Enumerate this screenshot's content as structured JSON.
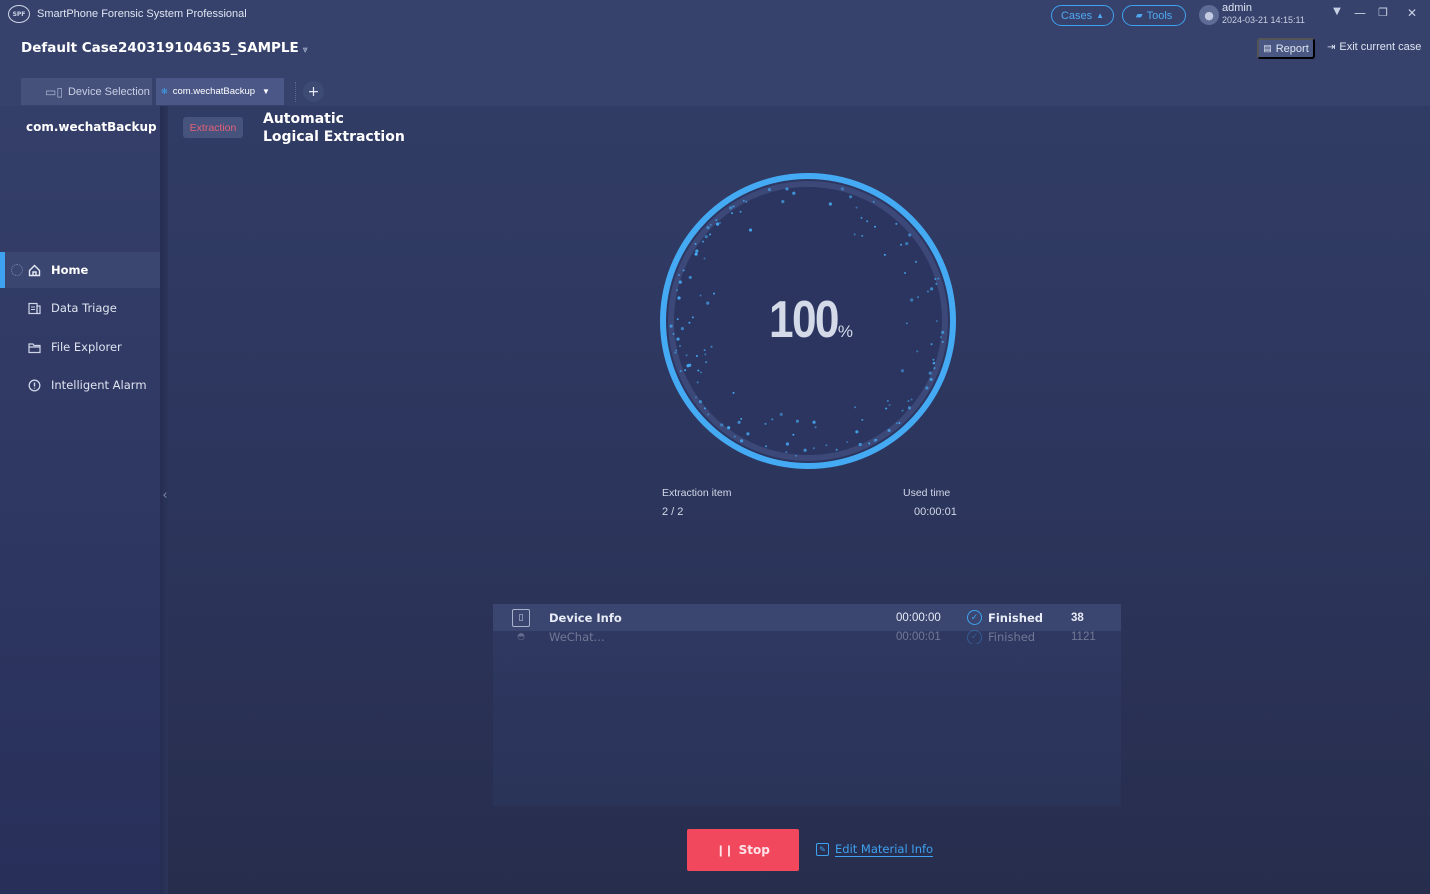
{
  "app": {
    "title": "SmartPhone Forensic System Professional",
    "logo_text": "SPF"
  },
  "header": {
    "cases_label": "Cases",
    "tools_label": "Tools",
    "user": {
      "name": "admin",
      "datetime": "2024-03-21 14:15:11"
    },
    "window_controls": {
      "menu": "▼",
      "minimize": "—",
      "restore": "❐",
      "close": "✕"
    }
  },
  "case": {
    "title": "Default Case240319104635_SAMPLE",
    "caret": "⩔",
    "report_label": "Report",
    "exit_label": "Exit current case"
  },
  "tabs": [
    {
      "label": "Device Selection",
      "icon": "device-icon",
      "active": false
    },
    {
      "label": "com.wechatBackup",
      "icon": "dot-icon",
      "active": true
    }
  ],
  "tab_add_label": "+",
  "sidebar": {
    "title": "com.wechatBackup",
    "items": [
      {
        "label": "Home",
        "icon": "home-icon",
        "active": true
      },
      {
        "label": "Data Triage",
        "icon": "data-triage-icon",
        "active": false
      },
      {
        "label": "File Explorer",
        "icon": "folder-icon",
        "active": false
      },
      {
        "label": "Intelligent Alarm",
        "icon": "shield-alarm-icon",
        "active": false
      }
    ],
    "collapse_glyph": "‹"
  },
  "main": {
    "badge": "Extraction",
    "title_line1": "Automatic",
    "title_line2": "Logical Extraction",
    "progress": {
      "percent": 100,
      "percent_text": "100",
      "percent_sign": "%"
    },
    "stats": {
      "items_label": "Extraction item",
      "items_value": "2 / 2",
      "time_label": "Used time",
      "time_value": "00:00:01"
    },
    "results": [
      {
        "name": "Device Info",
        "time": "00:00:00",
        "status": "Finished",
        "count": "38"
      },
      {
        "name": "WeChat...",
        "time": "00:00:01",
        "status": "Finished",
        "count": "1121"
      }
    ],
    "stop_label": "Stop",
    "edit_label": "Edit Material Info"
  },
  "colors": {
    "accent": "#3fa2f0",
    "stop": "#f2485e",
    "badge_text": "#e6607a"
  }
}
